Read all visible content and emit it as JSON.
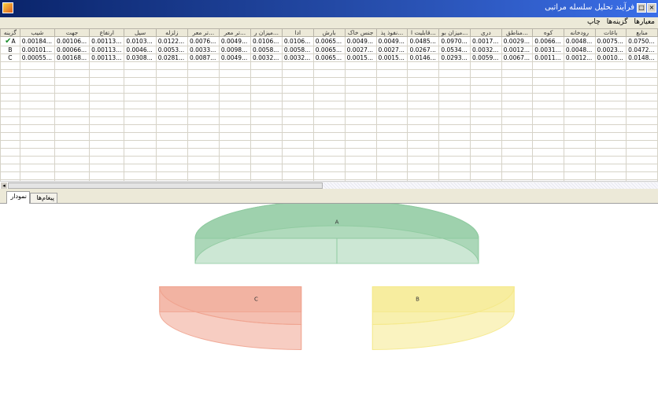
{
  "window": {
    "title": "فرآیند تحلیل سلسله مراتبی",
    "buttons": [
      "_",
      "□",
      "×"
    ]
  },
  "menu": {
    "items": [
      "معیارها",
      "گزینه‌ها",
      "چاپ"
    ]
  },
  "grid": {
    "columns": [
      "گزینه",
      "شیب",
      "جهت",
      "ارتفاع",
      "سیل",
      "زلزله",
      "...تر معر",
      "...تر معر",
      "...میزان ر",
      "ادا",
      "بارش",
      "جنس خاک",
      "...نفوذ پذ",
      "...قابلیت ا",
      "...میزان بو",
      "دری",
      "...مناطق",
      "کوه",
      "رودخانه",
      "باغات",
      "منابع"
    ],
    "rows": [
      {
        "option": "A",
        "selected": true,
        "values": [
          "0.00184...",
          "0.00106...",
          "0.00113...",
          "0.0103...",
          "0.0122...",
          "0.0076...",
          "0.0049...",
          "0.0106...",
          "0.0106...",
          "0.0065...",
          "0.0049...",
          "0.0049...",
          "0.0485...",
          "0.0970...",
          "0.0017...",
          "0.0029...",
          "0.0066...",
          "0.0048...",
          "0.0075...",
          "0.0750..."
        ]
      },
      {
        "option": "B",
        "selected": false,
        "values": [
          "0.00101...",
          "0.00066...",
          "0.00113...",
          "0.0046...",
          "0.0053...",
          "0.0033...",
          "0.0098...",
          "0.0058...",
          "0.0058...",
          "0.0065...",
          "0.0027...",
          "0.0027...",
          "0.0267...",
          "0.0534...",
          "0.0032...",
          "0.0012...",
          "0.0031...",
          "0.0048...",
          "0.0023...",
          "0.0472..."
        ]
      },
      {
        "option": "C",
        "selected": false,
        "values": [
          "0.00055...",
          "0.00168...",
          "0.00113...",
          "0.0308...",
          "0.0281...",
          "0.0087...",
          "0.0049...",
          "0.0032...",
          "0.0032...",
          "0.0065...",
          "0.0015...",
          "0.0015...",
          "0.0146...",
          "0.0293...",
          "0.0059...",
          "0.0067...",
          "0.0011...",
          "0.0012...",
          "0.0010...",
          "0.0148..."
        ]
      }
    ]
  },
  "tabs": [
    {
      "label": "نمودار",
      "active": true
    },
    {
      "label": "پیغام‌ها",
      "active": false
    }
  ],
  "chart_data": {
    "type": "pie",
    "categories": [
      "A",
      "B",
      "C"
    ],
    "values": [
      0.5,
      0.25,
      0.25
    ],
    "colors": [
      "#8fcaa0",
      "#f5e98c",
      "#f0a490"
    ]
  }
}
